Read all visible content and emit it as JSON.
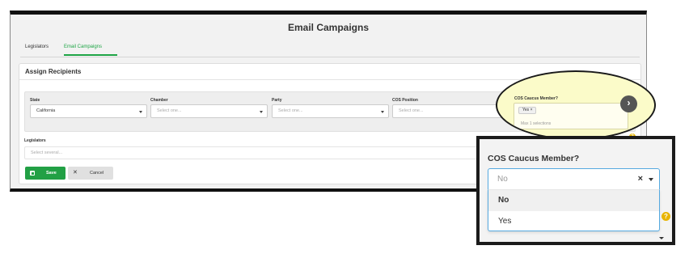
{
  "page": {
    "title": "Email Campaigns"
  },
  "tabs": [
    {
      "label": "Legislators",
      "active": false
    },
    {
      "label": "Email Campaigns",
      "active": true
    }
  ],
  "card": {
    "title": "Assign Recipients",
    "filters": {
      "state": {
        "label": "State",
        "value": "California"
      },
      "chamber": {
        "label": "Chamber",
        "placeholder": "Select one..."
      },
      "party": {
        "label": "Party",
        "placeholder": "Select one..."
      },
      "cos_position": {
        "label": "COS Position",
        "placeholder": "Select one..."
      }
    },
    "legislators": {
      "label": "Legislators",
      "placeholder": "Select several..."
    },
    "buttons": {
      "save": "Save",
      "cancel": "Cancel"
    }
  },
  "highlight": {
    "label": "COS Caucus Member?",
    "chip": "Yes",
    "chip_remove": "×",
    "hint": "Max 1 selections",
    "arrow_icon": "chevron-right-icon"
  },
  "zoom": {
    "label": "COS Caucus Member?",
    "value": "No",
    "clear": "×",
    "options": [
      "No",
      "Yes"
    ]
  },
  "colors": {
    "accent": "#22a045",
    "focus": "#55a9e0",
    "highlight": "#fbfbc9",
    "help": "#e8b400"
  }
}
